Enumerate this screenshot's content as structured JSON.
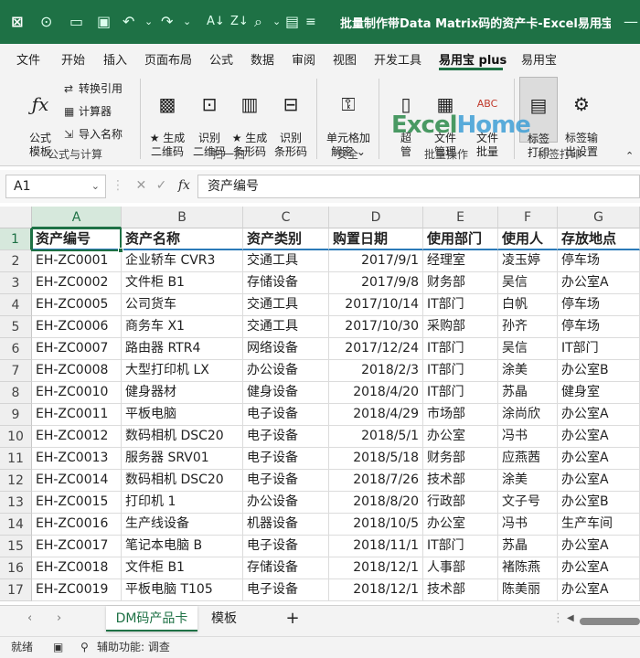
{
  "window": {
    "title": "批量制作带Data Matrix码的资产卡-Excel易用宝..."
  },
  "menu": {
    "tabs": [
      "文件",
      "开始",
      "插入",
      "页面布局",
      "公式",
      "数据",
      "审阅",
      "视图",
      "开发工具",
      "易用宝 plus",
      "易用宝"
    ],
    "active": "易用宝 plus"
  },
  "ribbon": {
    "formula_group": {
      "label": "公式与计算",
      "formula_template": "公式\n模板",
      "convert_ref": "转换引用",
      "calculator": "计算器",
      "import_name": "导入名称"
    },
    "scan_group": {
      "label": "扫一扫",
      "gen_2d": "★ 生成\n二维码",
      "read_2d": "识别\n二维码",
      "gen_barcode": "★ 生成\n条形码",
      "read_barcode": "识别\n条形码"
    },
    "security_group": {
      "label": "安全",
      "unlock_cells": "单元格加\n解密 ⌄"
    },
    "batch_group": {
      "label": "批量操作",
      "b1": "超\n管",
      "b2": "文件\n管理",
      "b3": "文件\n批量"
    },
    "label_group": {
      "label": "标签打印",
      "print": "标签\n打印",
      "settings": "标签输\n出设置"
    }
  },
  "watermark": {
    "text1": "Excel",
    "text2": "Home"
  },
  "formula_bar": {
    "cell_ref": "A1",
    "content": "资产编号",
    "fx": "fx"
  },
  "columns": [
    "A",
    "B",
    "C",
    "D",
    "E",
    "F",
    "G"
  ],
  "headers": [
    "资产编号",
    "资产名称",
    "资产类别",
    "购置日期",
    "使用部门",
    "使用人",
    "存放地点"
  ],
  "rows": [
    [
      "EH-ZC0001",
      "企业轿车 CVR3",
      "交通工具",
      "2017/9/1",
      "经理室",
      "凌玉婷",
      "停车场"
    ],
    [
      "EH-ZC0002",
      "文件柜 B1",
      "存储设备",
      "2017/9/8",
      "财务部",
      "吴信",
      "办公室A"
    ],
    [
      "EH-ZC0005",
      "公司货车",
      "交通工具",
      "2017/10/14",
      "IT部门",
      "白帆",
      "停车场"
    ],
    [
      "EH-ZC0006",
      "商务车 X1",
      "交通工具",
      "2017/10/30",
      "采购部",
      "孙齐",
      "停车场"
    ],
    [
      "EH-ZC0007",
      "路由器 RTR4",
      "网络设备",
      "2017/12/24",
      "IT部门",
      "吴信",
      "IT部门"
    ],
    [
      "EH-ZC0008",
      "大型打印机 LX",
      "办公设备",
      "2018/2/3",
      "IT部门",
      "涂美",
      "办公室B"
    ],
    [
      "EH-ZC0010",
      "健身器材",
      "健身设备",
      "2018/4/20",
      "IT部门",
      "苏晶",
      "健身室"
    ],
    [
      "EH-ZC0011",
      "平板电脑",
      "电子设备",
      "2018/4/29",
      "市场部",
      "涂尚欣",
      "办公室A"
    ],
    [
      "EH-ZC0012",
      "数码相机 DSC20",
      "电子设备",
      "2018/5/1",
      "办公室",
      "冯书",
      "办公室A"
    ],
    [
      "EH-ZC0013",
      "服务器 SRV01",
      "电子设备",
      "2018/5/18",
      "财务部",
      "应燕茜",
      "办公室A"
    ],
    [
      "EH-ZC0014",
      "数码相机 DSC20",
      "电子设备",
      "2018/7/26",
      "技术部",
      "涂美",
      "办公室A"
    ],
    [
      "EH-ZC0015",
      "打印机 1",
      "办公设备",
      "2018/8/20",
      "行政部",
      "文子号",
      "办公室B"
    ],
    [
      "EH-ZC0016",
      "生产线设备",
      "机器设备",
      "2018/10/5",
      "办公室",
      "冯书",
      "生产车间"
    ],
    [
      "EH-ZC0017",
      "笔记本电脑 B",
      "电子设备",
      "2018/11/1",
      "IT部门",
      "苏晶",
      "办公室A"
    ],
    [
      "EH-ZC0018",
      "文件柜 B1",
      "存储设备",
      "2018/12/1",
      "人事部",
      "褚陈燕",
      "办公室A"
    ],
    [
      "EH-ZC0019",
      "平板电脑 T105",
      "电子设备",
      "2018/12/1",
      "技术部",
      "陈美丽",
      "办公室A"
    ]
  ],
  "row_numbers": [
    "1",
    "2",
    "3",
    "4",
    "5",
    "6",
    "7",
    "8",
    "9",
    "10",
    "11",
    "12",
    "13",
    "14",
    "15",
    "16",
    "17"
  ],
  "sheets": {
    "tabs": [
      "DM码产品卡",
      "模板"
    ],
    "active": "DM码产品卡",
    "add": "+"
  },
  "status": {
    "ready": "就绪",
    "accessibility": "辅助功能: 调查"
  }
}
